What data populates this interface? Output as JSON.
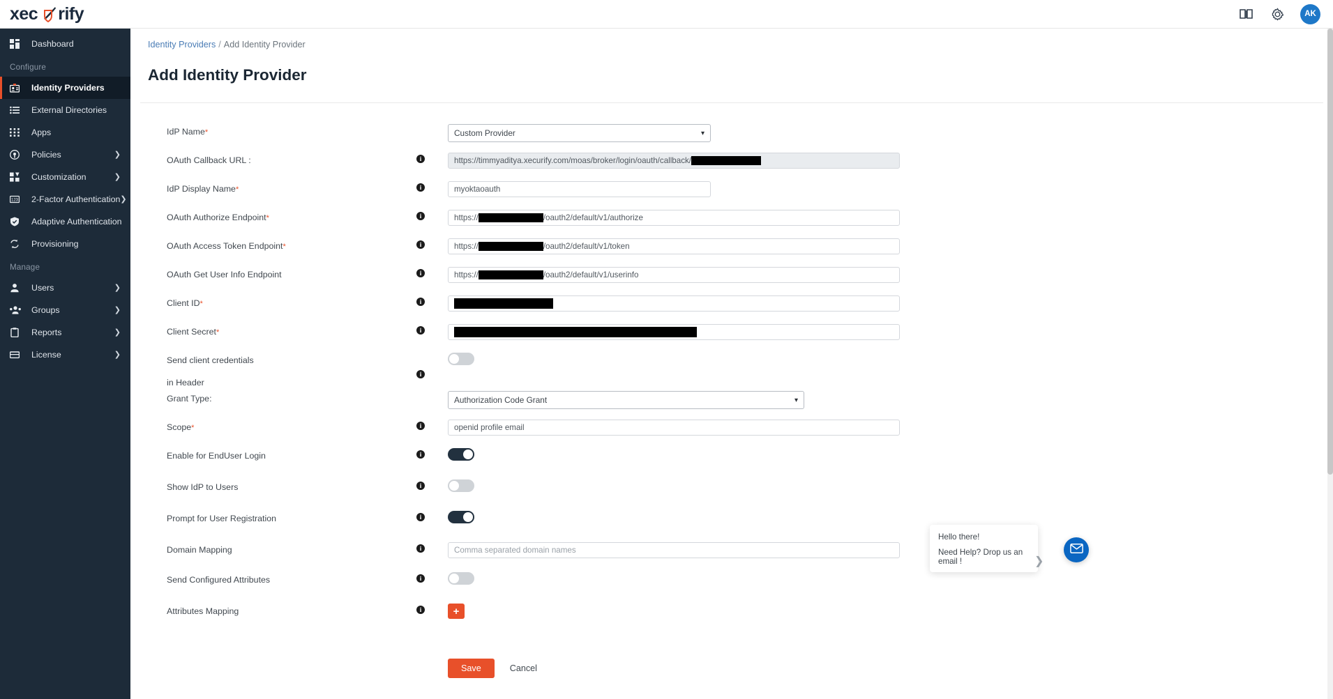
{
  "brand": {
    "name_part1": "xec",
    "name_part2": "rify"
  },
  "topbar": {
    "docs_icon": "book-icon",
    "settings_icon": "gear-icon",
    "avatar_initials": "AK"
  },
  "sidebar": {
    "items": [
      {
        "label": "Dashboard",
        "icon": "dashboard-icon",
        "key": "dashboard",
        "active": false,
        "chevron": false
      },
      {
        "label": "Identity Providers",
        "icon": "identity-providers-icon",
        "key": "identity-providers",
        "active": true,
        "chevron": false
      },
      {
        "label": "External Directories",
        "icon": "external-directories-icon",
        "key": "external-directories",
        "active": false,
        "chevron": false
      },
      {
        "label": "Apps",
        "icon": "apps-grid-icon",
        "key": "apps",
        "active": false,
        "chevron": false
      },
      {
        "label": "Policies",
        "icon": "policies-shield-icon",
        "key": "policies",
        "active": false,
        "chevron": true
      },
      {
        "label": "Customization",
        "icon": "customization-icon",
        "key": "customization",
        "active": false,
        "chevron": true
      },
      {
        "label": "2-Factor Authentication",
        "icon": "two-factor-icon",
        "key": "2fa",
        "active": false,
        "chevron": true
      },
      {
        "label": "Adaptive Authentication",
        "icon": "adaptive-shield-check-icon",
        "key": "adaptive",
        "active": false,
        "chevron": false
      },
      {
        "label": "Provisioning",
        "icon": "provisioning-sync-icon",
        "key": "provisioning",
        "active": false,
        "chevron": false
      },
      {
        "label": "Users",
        "icon": "user-icon",
        "key": "users",
        "active": false,
        "chevron": true
      },
      {
        "label": "Groups",
        "icon": "groups-icon",
        "key": "groups",
        "active": false,
        "chevron": true
      },
      {
        "label": "Reports",
        "icon": "reports-clipboard-icon",
        "key": "reports",
        "active": false,
        "chevron": true
      },
      {
        "label": "License",
        "icon": "license-card-icon",
        "key": "license",
        "active": false,
        "chevron": true
      }
    ],
    "section_configure": "Configure",
    "section_manage": "Manage"
  },
  "breadcrumb": {
    "parent": "Identity Providers",
    "separator": "/",
    "current": "Add Identity Provider"
  },
  "page": {
    "title": "Add Identity Provider"
  },
  "form": {
    "idp_name": {
      "label": "IdP Name",
      "required": true,
      "value": "Custom Provider"
    },
    "oauth_callback_url": {
      "label": "OAuth Callback URL :",
      "required": false,
      "value": "https://timmyaditya.xecurify.com/moas/broker/login/oauth/callback/",
      "redacted": true
    },
    "idp_display_name": {
      "label": "IdP Display Name",
      "required": true,
      "value": "myoktaoauth"
    },
    "oauth_authorize_endpoint": {
      "label": "OAuth Authorize Endpoint",
      "required": true,
      "prefix": "https://",
      "suffix": "/oauth2/default/v1/authorize",
      "redacted": true
    },
    "oauth_access_token_endpoint": {
      "label": "OAuth Access Token Endpoint",
      "required": true,
      "prefix": "https://",
      "suffix": "/oauth2/default/v1/token",
      "redacted": true
    },
    "oauth_get_user_info_endpoint": {
      "label": "OAuth Get User Info Endpoint",
      "required": false,
      "prefix": "https://",
      "suffix": "/oauth2/default/v1/userinfo",
      "redacted": true
    },
    "client_id": {
      "label": "Client ID",
      "required": true,
      "value": "",
      "redacted": true
    },
    "client_secret": {
      "label": "Client Secret",
      "required": true,
      "value": "",
      "redacted": true
    },
    "send_client_credentials": {
      "label_line1": "Send client credentials",
      "label_line2": "in Header",
      "state": "off"
    },
    "grant_type": {
      "label": "Grant Type:",
      "required": false,
      "value": "Authorization Code Grant"
    },
    "scope": {
      "label": "Scope",
      "required": true,
      "value": "openid profile email"
    },
    "enable_enduser_login": {
      "label": "Enable for EndUser Login",
      "state": "on"
    },
    "show_idp_to_users": {
      "label": "Show IdP to Users",
      "state": "off"
    },
    "prompt_user_registration": {
      "label": "Prompt for User Registration",
      "state": "on"
    },
    "domain_mapping": {
      "label": "Domain Mapping",
      "placeholder": "Comma separated domain names",
      "value": ""
    },
    "send_configured_attributes": {
      "label": "Send Configured Attributes",
      "state": "off"
    },
    "attributes_mapping": {
      "label": "Attributes Mapping",
      "add_label": "+"
    }
  },
  "actions": {
    "save_label": "Save",
    "cancel_label": "Cancel"
  },
  "chat": {
    "greeting": "Hello there!",
    "message": "Need Help? Drop us an email !",
    "expand_icon": "chevron-right-icon",
    "fab_icon": "envelope-icon"
  },
  "colors": {
    "accent": "#e8502a",
    "sidebar": "#1d2b39",
    "toggle_on": "#22313f",
    "link": "#4a7cb5",
    "avatar": "#1e78c8"
  }
}
